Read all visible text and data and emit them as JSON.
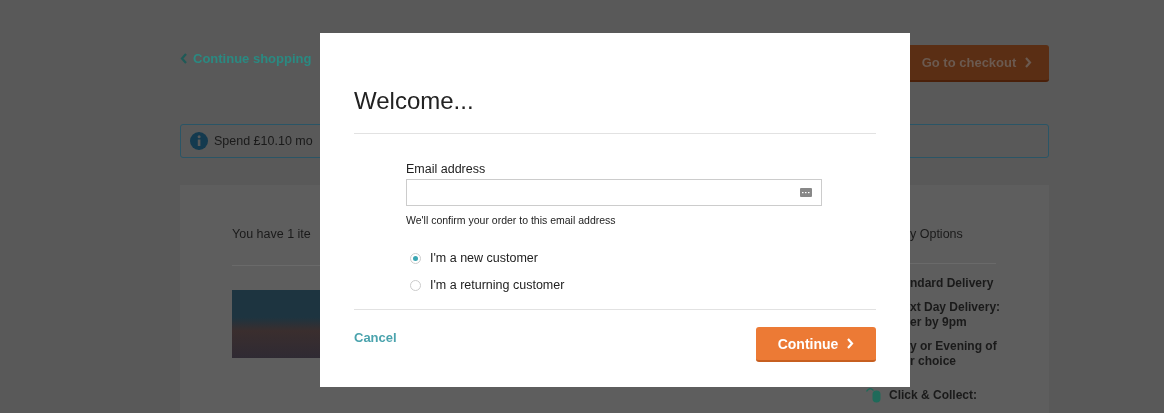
{
  "page": {
    "back_link": "Continue shopping",
    "checkout_button": "Go to checkout",
    "banner": "Spend £10.10 mo",
    "basket_summary": "You have 1 ite",
    "delivery_heading": "y Options",
    "delivery_options": [
      {
        "kind": "text",
        "lines": [
          "ndard Delivery"
        ]
      },
      {
        "kind": "text",
        "lines": [
          "xt Day Delivery:",
          "er by 9pm"
        ]
      },
      {
        "kind": "text",
        "lines": [
          "y or Evening of",
          "r choice"
        ]
      },
      {
        "kind": "collect",
        "lines": [
          "Click & Collect:"
        ]
      }
    ]
  },
  "dialog": {
    "title": "Welcome...",
    "email_label": "Email address",
    "email_hint": "We'll confirm your order to this email address",
    "customer_types": [
      {
        "label": "I'm a new customer",
        "selected": true
      },
      {
        "label": "I'm a returning customer",
        "selected": false
      }
    ],
    "cancel": "Cancel",
    "continue": "Continue"
  }
}
